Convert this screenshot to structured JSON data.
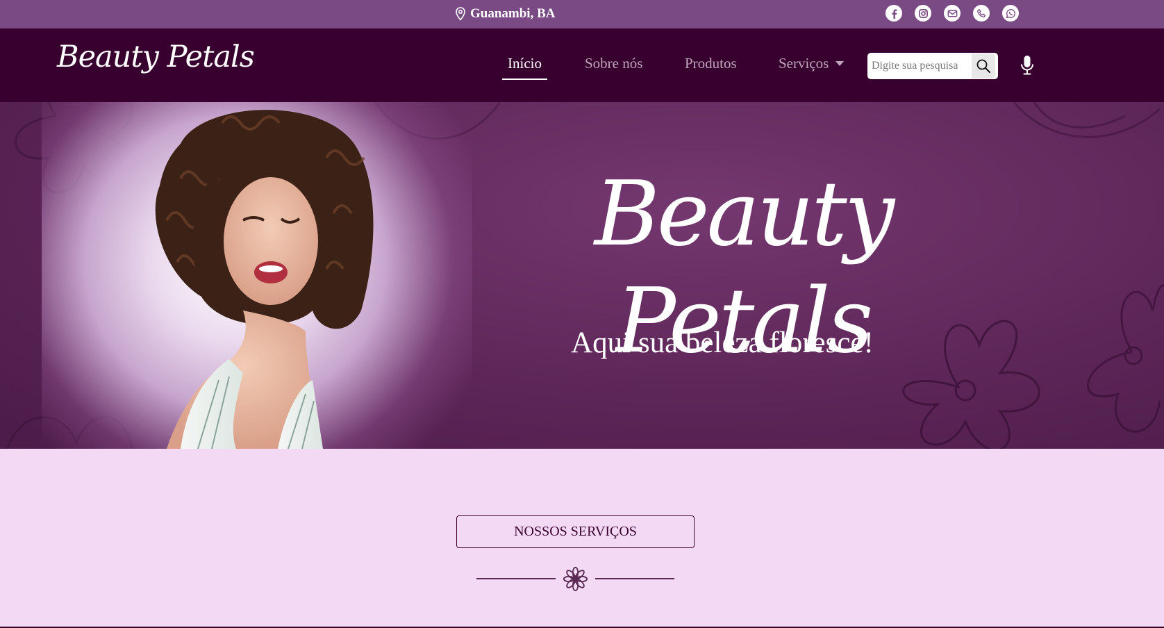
{
  "topbar": {
    "location": "Guanambi, BA",
    "socials": [
      {
        "icon": "facebook-icon"
      },
      {
        "icon": "instagram-icon"
      },
      {
        "icon": "email-icon"
      },
      {
        "icon": "phone-icon"
      },
      {
        "icon": "whatsapp-icon"
      }
    ]
  },
  "navbar": {
    "logo": "Beauty Petals",
    "links": {
      "inicio": "Início",
      "sobre": "Sobre nós",
      "produtos": "Produtos",
      "servicos": "Serviços"
    },
    "search_placeholder": "Digite sua pesquisa"
  },
  "hero": {
    "title": "Beauty Petals",
    "subtitle": "Aqui sua beleza floresce!"
  },
  "services": {
    "heading": "NOSSOS SERVIÇOS"
  },
  "colors": {
    "topbar": "#7a4a85",
    "navbar": "#38002e",
    "hero": "#5d2658",
    "page": "#f3d9f4"
  }
}
